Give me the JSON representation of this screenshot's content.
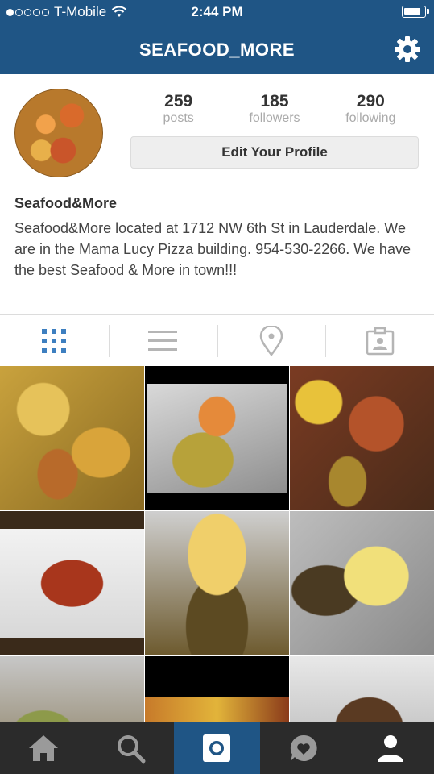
{
  "status": {
    "carrier": "T-Mobile",
    "time": "2:44 PM"
  },
  "nav": {
    "title": "SEAFOOD_MORE"
  },
  "profile": {
    "posts_count": "259",
    "posts_label": "posts",
    "followers_count": "185",
    "followers_label": "followers",
    "following_count": "290",
    "following_label": "following",
    "edit_label": "Edit Your Profile",
    "name": "Seafood&More",
    "bio": "Seafood&More located at 1712 NW 6th St in Lauderdale. We are in the Mama Lucy Pizza building. 954-530-2266. We have the best Seafood & More in town!!!"
  },
  "tabs": [
    "grid-icon",
    "list-icon",
    "location-pin-icon",
    "tagged-photos-icon"
  ],
  "tabbar": [
    "home-icon",
    "search-icon",
    "camera-icon",
    "activity-icon",
    "profile-icon"
  ],
  "colors": {
    "brand": "#1f5585",
    "tabbar": "#2b2b2b",
    "active_tab": "#3d7fc0",
    "inactive_tab": "#b5b5b5"
  }
}
